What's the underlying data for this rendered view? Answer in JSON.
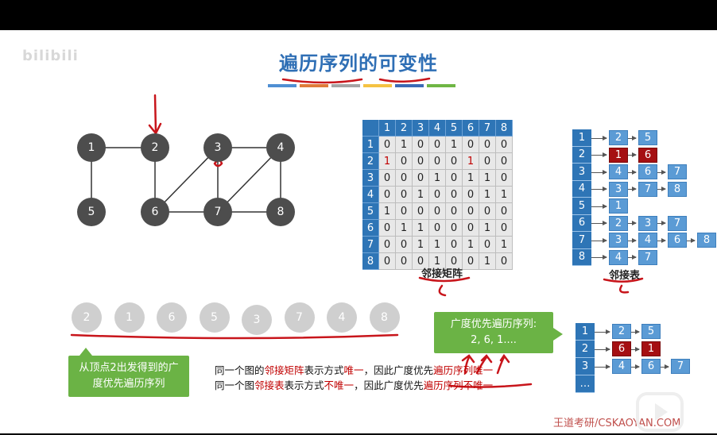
{
  "slide": {
    "title": "遍历序列的可变性",
    "logo_text": "bilibili",
    "color_bar": [
      "#4f8fd3",
      "#e07b39",
      "#a5a5a5",
      "#f5c242",
      "#3c6bb6",
      "#6fb644"
    ],
    "graph_nodes": [
      {
        "label": "1"
      },
      {
        "label": "2"
      },
      {
        "label": "3"
      },
      {
        "label": "4"
      },
      {
        "label": "5"
      },
      {
        "label": "6"
      },
      {
        "label": "7"
      },
      {
        "label": "8"
      }
    ],
    "matrix": {
      "headers": [
        "1",
        "2",
        "3",
        "4",
        "5",
        "6",
        "7",
        "8"
      ],
      "rows": [
        [
          "0",
          "1",
          "0",
          "0",
          "1",
          "0",
          "0",
          "0"
        ],
        [
          "1",
          "0",
          "0",
          "0",
          "0",
          "1",
          "0",
          "0"
        ],
        [
          "0",
          "0",
          "0",
          "1",
          "0",
          "1",
          "1",
          "0"
        ],
        [
          "0",
          "0",
          "1",
          "0",
          "0",
          "0",
          "1",
          "1"
        ],
        [
          "1",
          "0",
          "0",
          "0",
          "0",
          "0",
          "0",
          "0"
        ],
        [
          "0",
          "1",
          "1",
          "0",
          "0",
          "0",
          "1",
          "0"
        ],
        [
          "0",
          "0",
          "1",
          "1",
          "0",
          "1",
          "0",
          "1"
        ],
        [
          "0",
          "0",
          "0",
          "1",
          "0",
          "0",
          "1",
          "0"
        ]
      ],
      "caption": "邻接矩阵"
    },
    "adj_list": {
      "rows": [
        {
          "head": "1",
          "items": [
            "2",
            "5"
          ]
        },
        {
          "head": "2",
          "items": [
            "1",
            "6"
          ]
        },
        {
          "head": "3",
          "items": [
            "4",
            "6",
            "7"
          ]
        },
        {
          "head": "4",
          "items": [
            "3",
            "7",
            "8"
          ]
        },
        {
          "head": "5",
          "items": [
            "1"
          ]
        },
        {
          "head": "6",
          "items": [
            "2",
            "3",
            "7"
          ]
        },
        {
          "head": "7",
          "items": [
            "3",
            "4",
            "6",
            "8"
          ]
        },
        {
          "head": "8",
          "items": [
            "4",
            "7"
          ]
        }
      ],
      "caption": "邻接表"
    },
    "adj_list_2": {
      "rows": [
        {
          "head": "1",
          "items": [
            "2",
            "5"
          ]
        },
        {
          "head": "2",
          "items": [
            "6",
            "1"
          ]
        },
        {
          "head": "3",
          "items": [
            "4",
            "6",
            "7"
          ]
        },
        {
          "head": "…",
          "items": []
        }
      ]
    },
    "bfs_sequence": [
      "2",
      "1",
      "6",
      "5",
      "3",
      "7",
      "4",
      "8"
    ],
    "callout_left": "从顶点2出发得到的广度优先遍历序列",
    "callout_right": {
      "title": "广度优先遍历序列:",
      "sequence": "2, 6, 1...."
    },
    "statement1": {
      "a": "同一个图的",
      "b": "邻接矩阵",
      "c": "表示方式",
      "d": "唯一",
      "e": "，因此广度优先",
      "f": "遍历序列唯一"
    },
    "statement2": {
      "a": "同一个图",
      "b": "邻接表",
      "c": "表示方式",
      "d": "不唯一",
      "e": "，因此广度优先",
      "f": "遍历序列不唯一"
    },
    "watermark": "王道考研/CSKAOYAN.COM"
  }
}
